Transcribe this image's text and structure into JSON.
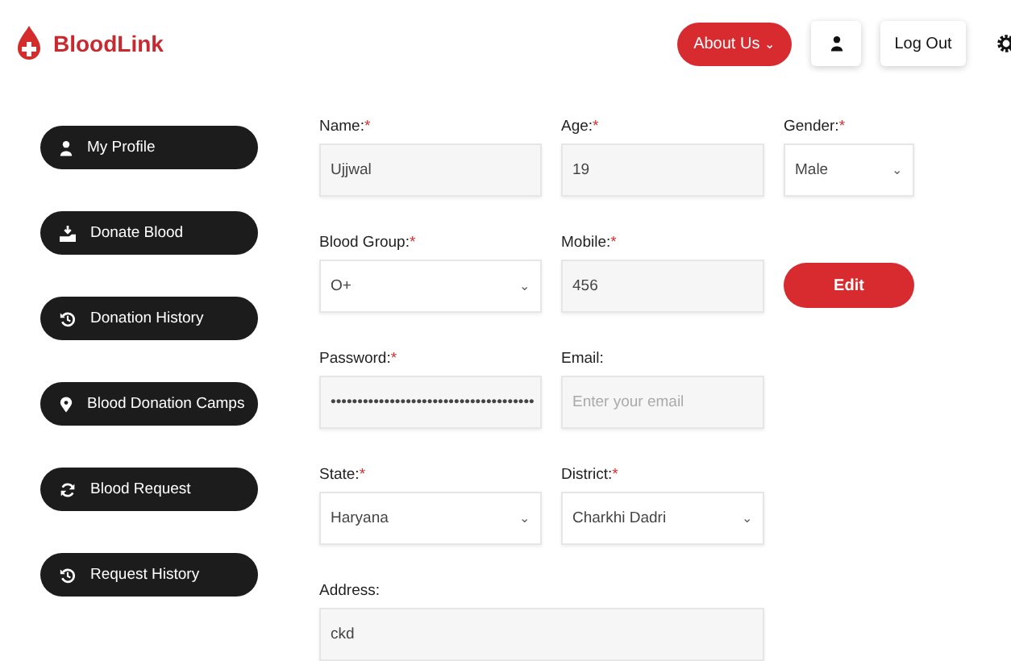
{
  "brand": {
    "name": "BloodLink"
  },
  "header": {
    "about": {
      "label": "About Us",
      "caret": "⌄"
    },
    "logout": {
      "label": "Log Out"
    }
  },
  "sidebar": {
    "items": [
      {
        "label": "My Profile"
      },
      {
        "label": "Donate Blood"
      },
      {
        "label": "Donation History"
      },
      {
        "label": "Blood Donation Camps"
      },
      {
        "label": "Blood Request"
      },
      {
        "label": "Request History"
      }
    ]
  },
  "form": {
    "fields": [
      {
        "label": "Name:",
        "mark": "*",
        "kind": "text",
        "value": "Ujjwal"
      },
      {
        "label": "Age:",
        "mark": "*",
        "kind": "text",
        "value": "19"
      },
      {
        "label": "Gender:",
        "mark": "*",
        "kind": "select",
        "value": "Male",
        "caret": "⌄"
      },
      {
        "label": "Blood Group:",
        "mark": "*",
        "kind": "select",
        "value": "O+",
        "caret": "⌄"
      },
      {
        "label": "Mobile:",
        "mark": "*",
        "kind": "text",
        "value": "456"
      },
      {
        "kind": "button",
        "label": "Edit"
      },
      {
        "label": "Password:",
        "mark": "*",
        "kind": "text",
        "value": "••••••••••••••••••••••••••••••••••••••"
      },
      {
        "label": "Email:",
        "kind": "text",
        "placeholder": "Enter your email"
      },
      {
        "kind": "blank"
      },
      {
        "label": "State:",
        "mark": "*",
        "kind": "select",
        "value": "Haryana",
        "caret": "⌄"
      },
      {
        "label": "District:",
        "mark": "*",
        "kind": "select",
        "value": "Charkhi Dadri",
        "caret": "⌄"
      },
      {
        "kind": "blank"
      },
      {
        "label": "Address:",
        "kind": "wide",
        "value": "ckd"
      }
    ]
  }
}
